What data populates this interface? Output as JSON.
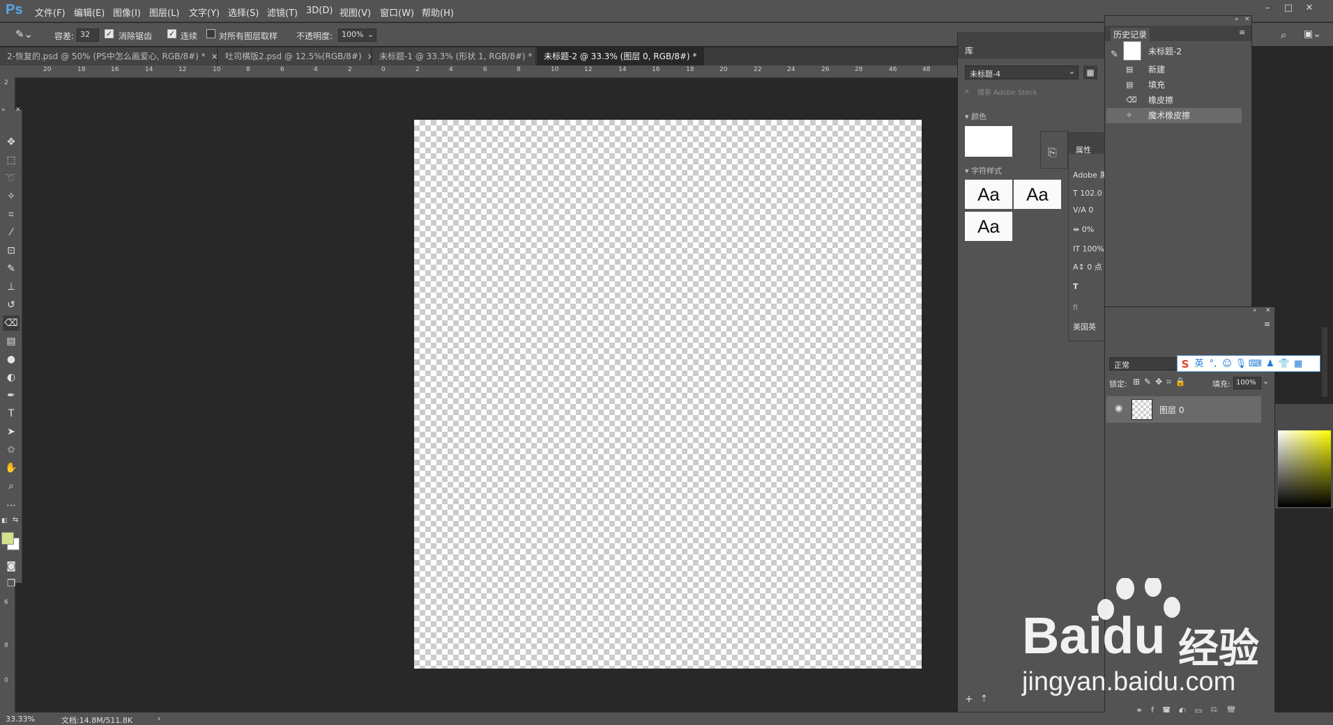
{
  "app": {
    "logo": "Ps"
  },
  "menu": [
    "文件(F)",
    "编辑(E)",
    "图像(I)",
    "图层(L)",
    "文字(Y)",
    "选择(S)",
    "滤镜(T)",
    "3D(D)",
    "视图(V)",
    "窗口(W)",
    "帮助(H)"
  ],
  "window_controls": [
    "–",
    "□",
    "✕"
  ],
  "options": {
    "tolerance_label": "容差:",
    "tolerance_value": "32",
    "antialias_label": "消除锯齿",
    "contiguous_label": "连续",
    "sample_all_label": "对所有图层取样",
    "opacity_label": "不透明度:",
    "opacity_value": "100%"
  },
  "tabs": [
    {
      "label": "2-恢复的.psd @ 50% (PS中怎么画爱心, RGB/8#) *"
    },
    {
      "label": "吐司横版2.psd @ 12.5%(RGB/8#)"
    },
    {
      "label": "未标题-1 @ 33.3% (形状 1, RGB/8#) *"
    },
    {
      "label": "未标题-2 @ 33.3% (图层 0, RGB/8#) *"
    }
  ],
  "ruler_top": [
    "20",
    "18",
    "16",
    "14",
    "12",
    "10",
    "8",
    "6",
    "4",
    "2",
    "0",
    "2",
    "4",
    "6",
    "8",
    "10",
    "12",
    "14",
    "16",
    "18",
    "20",
    "22",
    "24",
    "26",
    "28",
    "46",
    "48"
  ],
  "ruler_left": [
    "2",
    "6",
    "8",
    "0"
  ],
  "status": {
    "zoom": "33.33%",
    "doc": "文档:14.8M/511.8K",
    "arrow": "›"
  },
  "library": {
    "tab": "库",
    "selector": "未标题-4",
    "search_placeholder": "搜索 Adobe Stock",
    "colors_label": "颜色",
    "char_styles_label": "字符样式",
    "swatches": [
      "Aa",
      "Aa",
      "Aa"
    ]
  },
  "properties": {
    "tab": "属性",
    "font": "Adobe 黑",
    "size": "102.0",
    "kerning": "0",
    "tracking": "0%",
    "vscale": "100%",
    "baseline": "0 点",
    "lang": "美国英"
  },
  "history": {
    "tab": "历史记录",
    "snapshot": "未标题-2",
    "items": [
      "新建",
      "填充",
      "橡皮擦",
      "魔术橡皮擦"
    ]
  },
  "layers": {
    "blend_mode": "正常",
    "lock_label": "锁定:",
    "fill_label": "填充:",
    "fill_value": "100%",
    "layer_name": "图层 0"
  },
  "ime": {
    "lang": "英"
  },
  "watermark": {
    "brand": "Baidu",
    "brand_suffix": "经验",
    "url": "jingyan.baidu.com"
  },
  "colors": {
    "accent": "#5aa8ea",
    "foreground": "#d4e18c",
    "background_swatch": "#ffffff"
  }
}
